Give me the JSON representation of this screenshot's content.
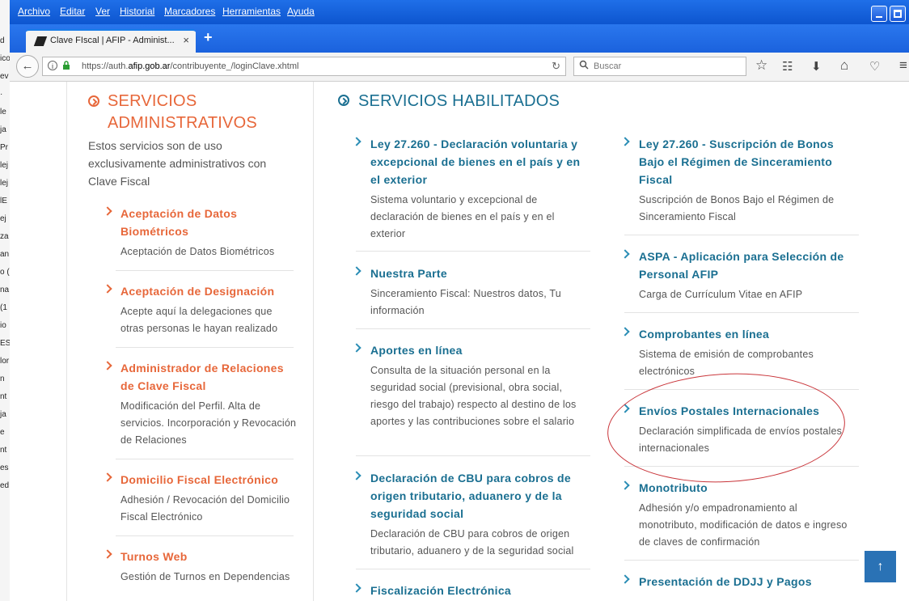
{
  "window_behind": {
    "fragments": [
      "d",
      "ico",
      "ev",
      "",
      "·",
      "le",
      "ja",
      "Pr",
      "lej",
      "lej",
      "lE",
      "ej",
      "za",
      "an",
      "o (",
      "na",
      "(1",
      "io",
      "",
      "ES",
      "lor",
      "n",
      "nt",
      "ja",
      "e",
      "nt",
      "es",
      "ed"
    ]
  },
  "menubar": {
    "items": [
      "Archivo",
      "Editar",
      "Ver",
      "Historial",
      "Marcadores",
      "Herramientas",
      "Ayuda"
    ],
    "buttons": [
      "minimize",
      "maximize",
      "close"
    ]
  },
  "tab": {
    "title": "Clave FIscal | AFIP - Administ...",
    "close": "×",
    "new_tab": "+"
  },
  "navbar": {
    "back_icon": "←",
    "info_icon": "i",
    "lock_icon": "🔒",
    "url_prefix": "https://auth.",
    "url_domain": "afip.gob.ar",
    "url_path": "/contribuyente_/loginClave.xhtml",
    "reload_icon": "↻",
    "search_icon": "⌕",
    "search_placeholder": "Buscar",
    "bookmark_icon": "☆",
    "reading_icon": "☷",
    "download_icon": "⬇",
    "home_icon": "⌂",
    "pocket_icon": "♡",
    "menu_icon": "≡"
  },
  "sidebar": {
    "title_line1": "SERVICIOS",
    "title_line2": "ADMINISTRATIVOS",
    "intro": "Estos servicios son de uso exclusivamente administrativos con Clave Fiscal",
    "items": [
      {
        "title": "Aceptación de Datos Biométricos",
        "desc": "Aceptación de Datos Biométricos"
      },
      {
        "title": "Aceptación de Designación",
        "desc": "Acepte aquí la delegaciones que otras personas le hayan realizado"
      },
      {
        "title": "Administrador de Relaciones de Clave Fiscal",
        "desc": "Modificación del Perfil. Alta de servicios. Incorporación y Revocación de Relaciones"
      },
      {
        "title": "Domicilio Fiscal Electrónico",
        "desc": "Adhesión / Revocación del Domicilio Fiscal Electrónico"
      },
      {
        "title": "Turnos Web",
        "desc": "Gestión de Turnos en Dependencias"
      }
    ]
  },
  "main": {
    "title": "SERVICIOS HABILITADOS",
    "col1": [
      {
        "title": "Ley 27.260 - Declaración voluntaria y excepcional de bienes en el país y en el exterior",
        "desc": "Sistema voluntario y excepcional de declaración de bienes en el país y en el exterior"
      },
      {
        "title": "Nuestra Parte",
        "desc": "Sinceramiento Fiscal: Nuestros datos, Tu información"
      },
      {
        "title": "Aportes en línea",
        "desc": "Consulta de la situación personal en la seguridad social (previsional, obra social, riesgo del trabajo) respecto al destino de los aportes y las contribuciones sobre el salario"
      },
      {
        "title": "Declaración de CBU para cobros de origen tributario, aduanero y de la seguridad social",
        "desc": "Declaración de CBU para cobros de origen tributario, aduanero y de la seguridad social"
      },
      {
        "title": "Fiscalización Electrónica",
        "desc": ""
      }
    ],
    "col2": [
      {
        "title": "Ley 27.260 - Suscripción de Bonos Bajo el Régimen de Sinceramiento Fiscal",
        "desc": "Suscripción de Bonos Bajo el Régimen de Sinceramiento Fiscal"
      },
      {
        "title": "ASPA - Aplicación para Selección de Personal AFIP",
        "desc": "Carga de Currículum Vitae en AFIP"
      },
      {
        "title": "Comprobantes en línea",
        "desc": "Sistema de emisión de comprobantes electrónicos"
      },
      {
        "title": "Envíos Postales Internacionales",
        "desc": "Declaración simplificada de envíos postales internacionales"
      },
      {
        "title": "Monotributo",
        "desc": "Adhesión y/o empadronamiento al monotributo, modificación de datos e ingreso de claves de confirmación"
      },
      {
        "title": "Presentación de DDJJ y Pagos",
        "desc": ""
      }
    ]
  },
  "back_to_top_icon": "↑",
  "colors": {
    "accent_orange": "#e7673a",
    "accent_blue": "#1a6f91",
    "window_blue": "#0a59d8",
    "annotation_red": "#c9353a"
  }
}
